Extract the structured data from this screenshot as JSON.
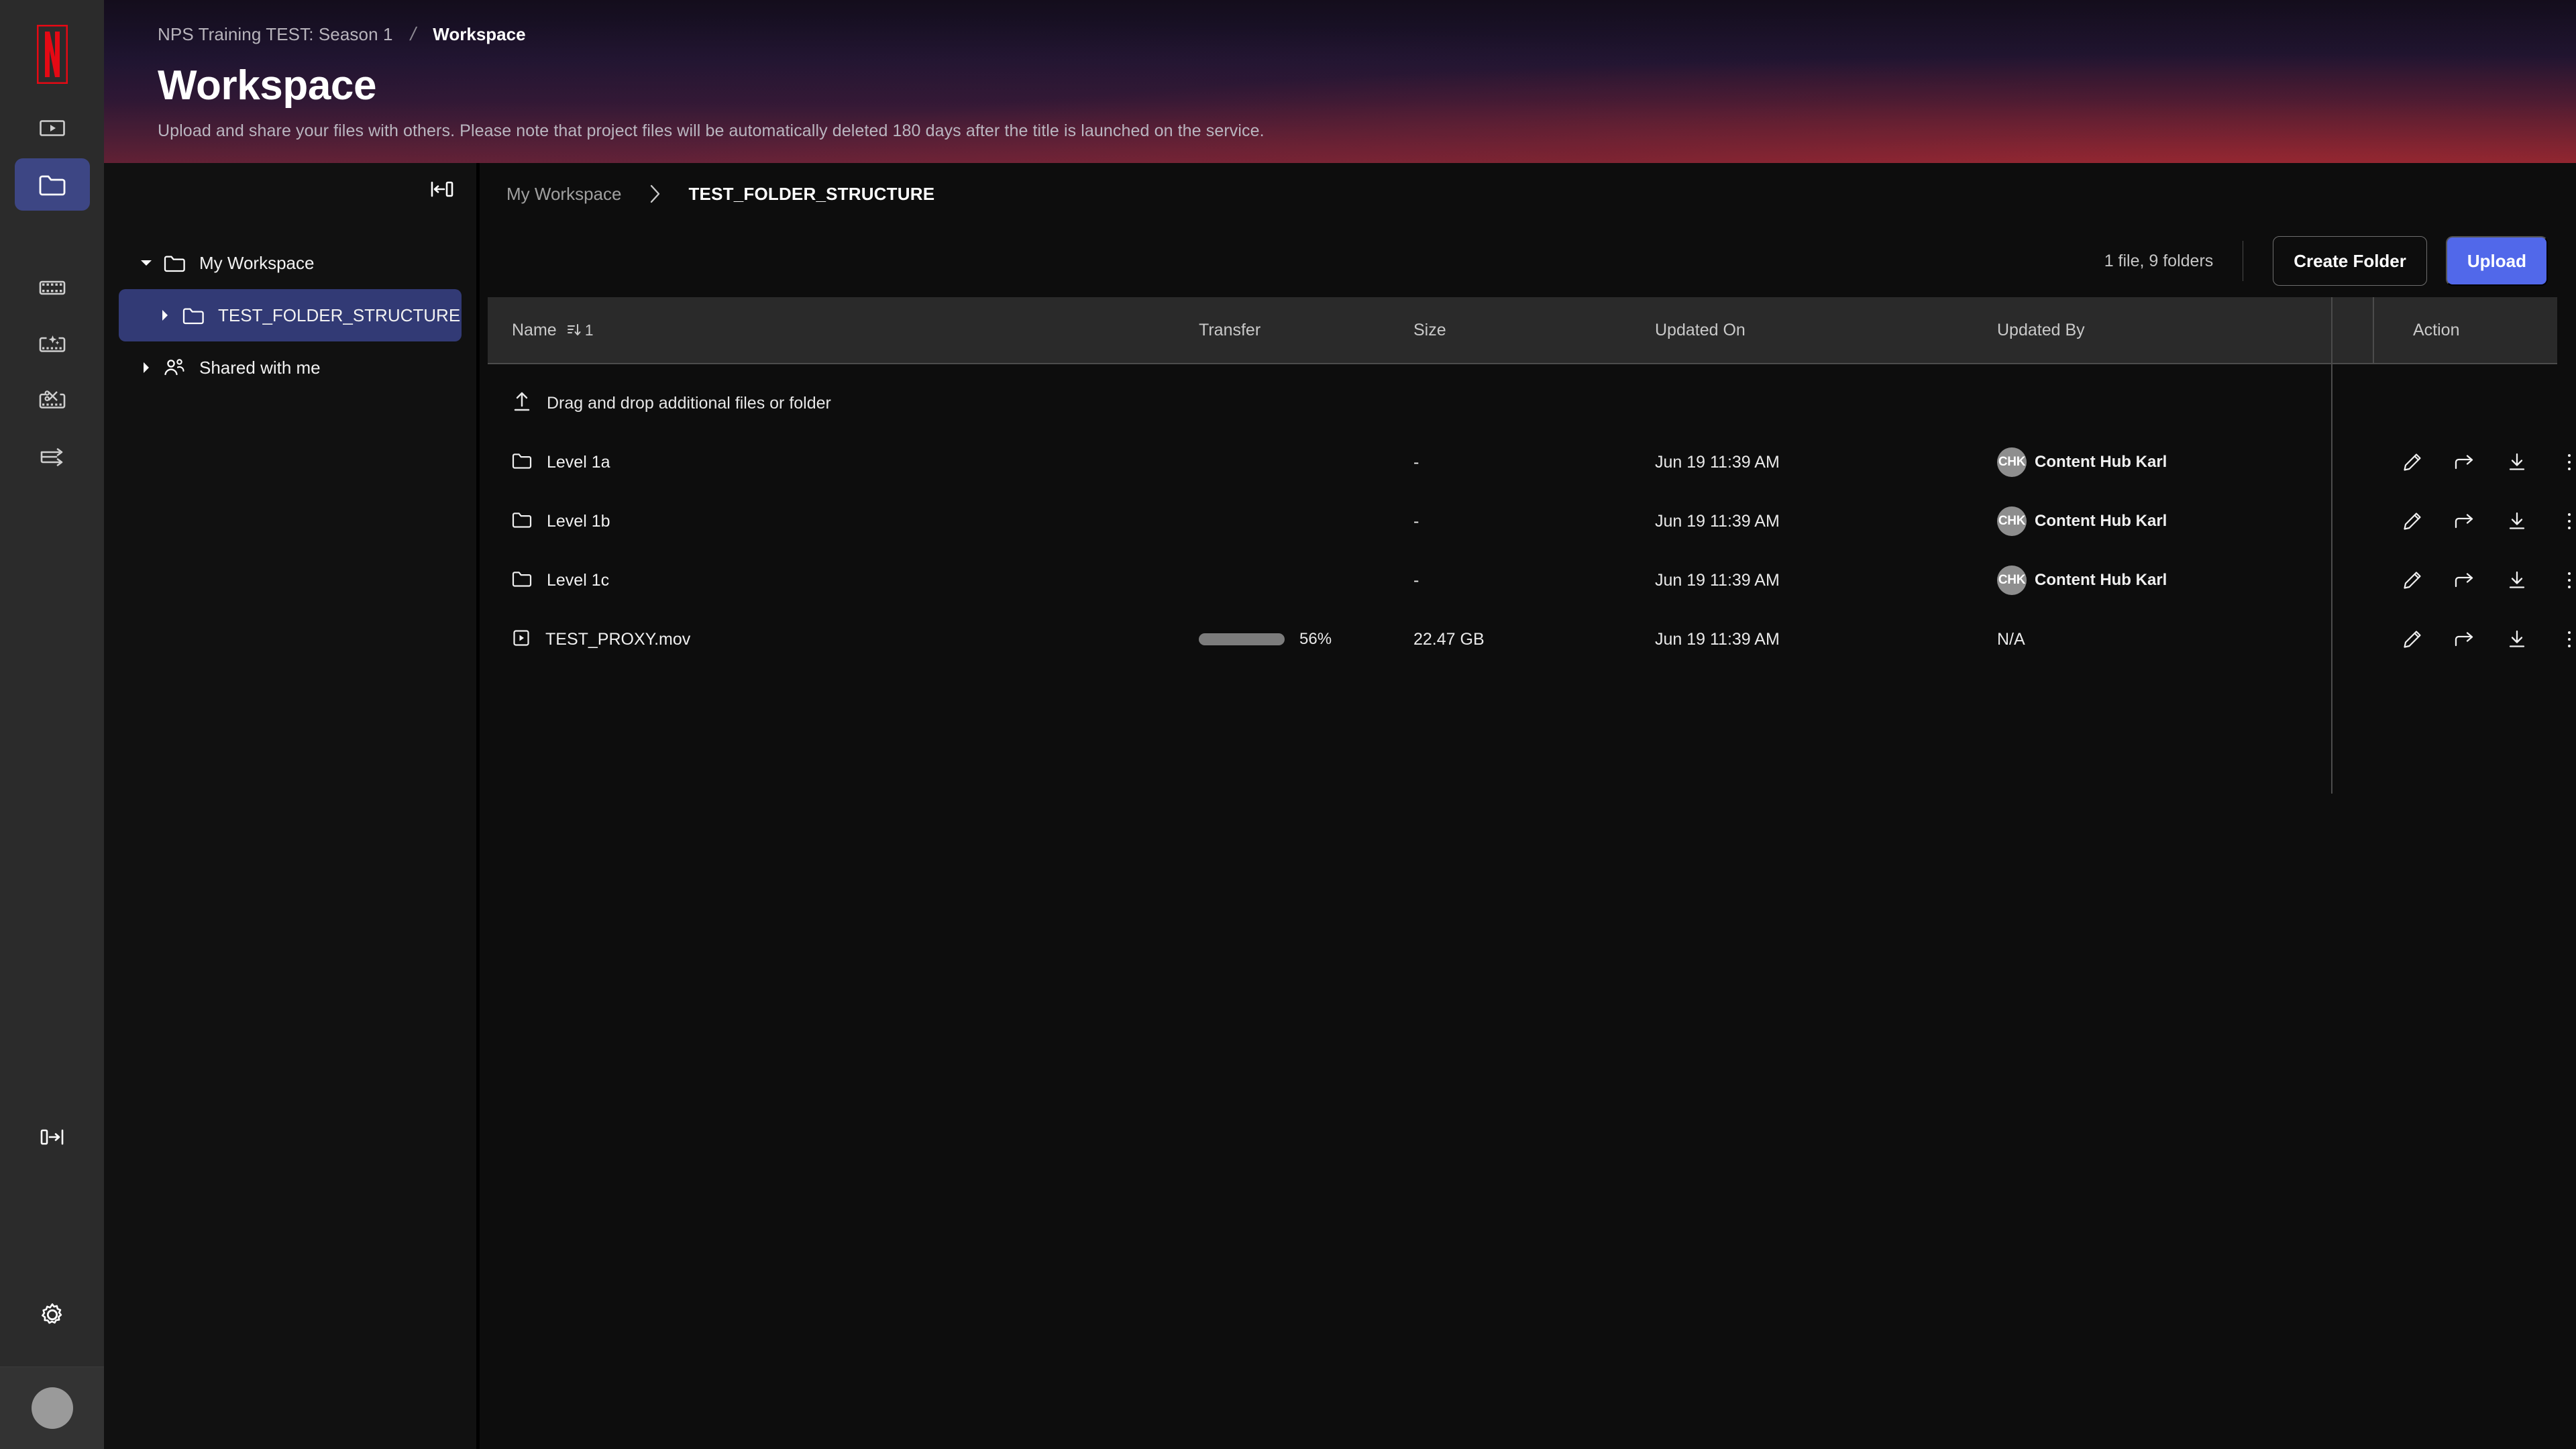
{
  "rail": {
    "logo": "netflix-logo",
    "items": [
      {
        "name": "player-icon",
        "active": false
      },
      {
        "name": "folder-icon",
        "active": true
      },
      {
        "name": "film-strip-icon",
        "active": false
      },
      {
        "name": "film-strip-sparkle-icon",
        "active": false
      },
      {
        "name": "film-strip-scissors-icon",
        "active": false
      },
      {
        "name": "transfer-arrow-icon",
        "active": false
      }
    ],
    "expand_icon": "panel-expand-icon",
    "settings_icon": "gear-icon",
    "avatar": "user-avatar"
  },
  "banner": {
    "breadcrumb_parent": "NPS Training TEST: Season 1",
    "breadcrumb_separator": "/",
    "breadcrumb_current": "Workspace",
    "title": "Workspace",
    "subtitle": "Upload and share your files with others. Please note that project files will be automatically deleted 180 days after the title is launched on the service."
  },
  "tree": {
    "collapse_icon": "panel-collapse-icon",
    "items": [
      {
        "label": "My Workspace",
        "caret": "down",
        "icon": "folder-icon",
        "selected": false,
        "indent": false
      },
      {
        "label": "TEST_FOLDER_STRUCTURE",
        "caret": "right",
        "icon": "folder-icon",
        "selected": true,
        "indent": true
      },
      {
        "label": "Shared with me",
        "caret": "right",
        "icon": "people-icon",
        "selected": false,
        "indent": false
      }
    ]
  },
  "content": {
    "breadcrumb": {
      "parent": "My Workspace",
      "chevron": "chevron-right-icon",
      "current": "TEST_FOLDER_STRUCTURE"
    },
    "toolbar": {
      "count_label": "1 file, 9 folders",
      "create_folder_label": "Create Folder",
      "upload_label": "Upload"
    },
    "table": {
      "columns": [
        {
          "key": "name",
          "label": "Name",
          "sort_icon": "sort-descending-icon",
          "sort_index": "1"
        },
        {
          "key": "transfer",
          "label": "Transfer"
        },
        {
          "key": "size",
          "label": "Size"
        },
        {
          "key": "updated_on",
          "label": "Updated On"
        },
        {
          "key": "updated_by",
          "label": "Updated By"
        },
        {
          "key": "action",
          "label": "Action"
        }
      ],
      "dropzone": {
        "icon": "upload-icon",
        "label": "Drag and drop additional files or folder"
      },
      "rows": [
        {
          "icon": "folder-icon",
          "name": "Level 1a",
          "transfer": null,
          "size": "-",
          "updated_on": "Jun 19 11:39 AM",
          "updated_by": {
            "initials": "CHK",
            "name": "Content Hub Karl"
          },
          "actions": [
            "edit-icon",
            "share-icon",
            "download-icon",
            "more-vertical-icon"
          ]
        },
        {
          "icon": "folder-icon",
          "name": "Level 1b",
          "transfer": null,
          "size": "-",
          "updated_on": "Jun 19 11:39 AM",
          "updated_by": {
            "initials": "CHK",
            "name": "Content Hub Karl"
          },
          "actions": [
            "edit-icon",
            "share-icon",
            "download-icon",
            "more-vertical-icon"
          ]
        },
        {
          "icon": "folder-icon",
          "name": "Level 1c",
          "transfer": null,
          "size": "-",
          "updated_on": "Jun 19 11:39 AM",
          "updated_by": {
            "initials": "CHK",
            "name": "Content Hub Karl"
          },
          "actions": [
            "edit-icon",
            "share-icon",
            "download-icon",
            "more-vertical-icon"
          ]
        },
        {
          "icon": "video-file-icon",
          "name": "TEST_PROXY.mov",
          "transfer": {
            "percent": 56,
            "label": "56%"
          },
          "size": "22.47 GB",
          "updated_on": "Jun 19 11:39 AM",
          "updated_by": {
            "initials": null,
            "name": "N/A"
          },
          "actions": [
            "edit-icon",
            "share-icon",
            "download-icon",
            "more-vertical-icon"
          ]
        }
      ]
    }
  },
  "colors": {
    "accent_primary": "#5168ea",
    "selected_tree": "#323a75",
    "rail_active": "#3d4684",
    "progress_fill": "#3bb35e",
    "progress_track": "#7c7c7c",
    "brand_red": "#e50914"
  }
}
